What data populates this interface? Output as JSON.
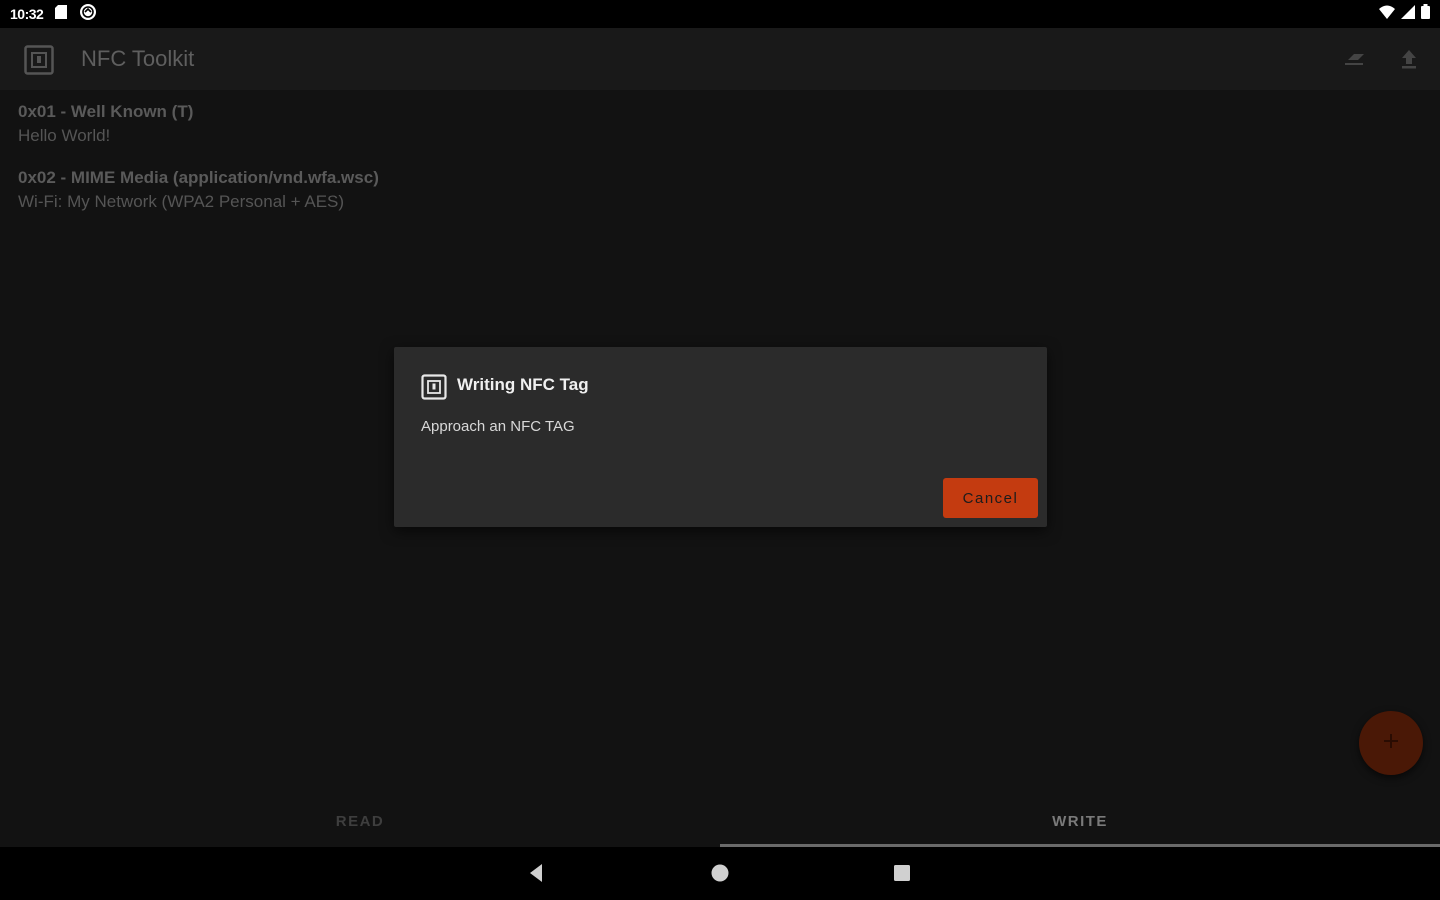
{
  "status_bar": {
    "time": "10:32",
    "icons": [
      "sd-card-icon",
      "sync-icon",
      "wifi-icon",
      "signal-icon",
      "battery-icon"
    ]
  },
  "app_bar": {
    "title": "NFC Toolkit",
    "actions": [
      "erase-icon",
      "upload-icon"
    ]
  },
  "records": [
    {
      "title": "0x01 - Well Known (T)",
      "body": "Hello World!"
    },
    {
      "title": "0x02 - MIME Media (application/vnd.wfa.wsc)",
      "body": "Wi-Fi: My Network (WPA2 Personal + AES)"
    }
  ],
  "dialog": {
    "title": "Writing NFC Tag",
    "message": "Approach an NFC TAG",
    "cancel_label": "Cancel"
  },
  "tabs": [
    {
      "label": "READ",
      "selected": false
    },
    {
      "label": "WRITE",
      "selected": true
    }
  ],
  "colors": {
    "accent": "#c43b10",
    "background": "#121212",
    "dialog": "#2b2b2b"
  }
}
